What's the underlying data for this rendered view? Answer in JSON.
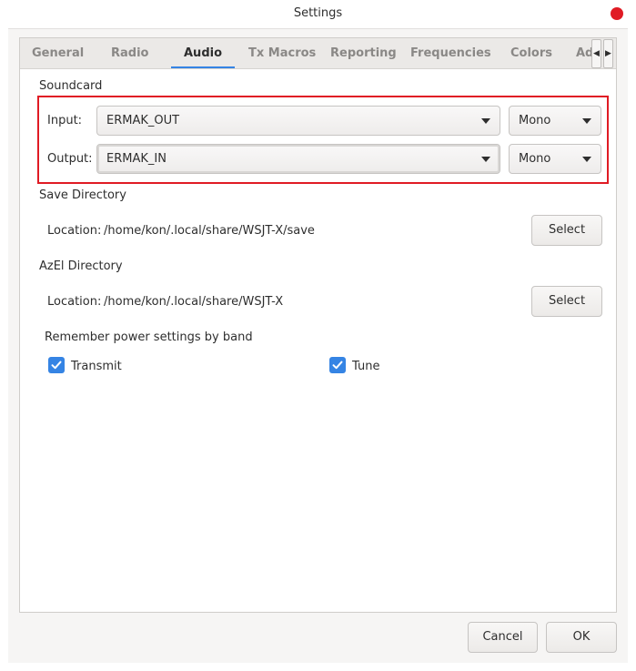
{
  "window": {
    "title": "Settings"
  },
  "tabs": [
    {
      "label": "General"
    },
    {
      "label": "Radio"
    },
    {
      "label": "Audio"
    },
    {
      "label": "Tx Macros"
    },
    {
      "label": "Reporting"
    },
    {
      "label": "Frequencies"
    },
    {
      "label": "Colors"
    },
    {
      "label": "Ad"
    }
  ],
  "active_tab": "Audio",
  "soundcard": {
    "heading": "Soundcard",
    "input_label": "Input:",
    "input_device": "ERMAK_OUT",
    "input_channel": "Mono",
    "output_label": "Output:",
    "output_device": "ERMAK_IN",
    "output_channel": "Mono"
  },
  "save_dir": {
    "heading": "Save Directory",
    "location_label": "Location:",
    "path": "/home/kon/.local/share/WSJT-X/save",
    "select_label": "Select"
  },
  "azel_dir": {
    "heading": "AzEl Directory",
    "location_label": "Location:",
    "path": "/home/kon/.local/share/WSJT-X",
    "select_label": "Select"
  },
  "power": {
    "heading": "Remember power settings by band",
    "transmit_label": "Transmit",
    "transmit_checked": true,
    "tune_label": "Tune",
    "tune_checked": true
  },
  "footer": {
    "cancel_label": "Cancel",
    "ok_label": "OK"
  },
  "colors": {
    "accent": "#3584e4",
    "highlight": "#e01b24",
    "close": "#e01b24"
  }
}
